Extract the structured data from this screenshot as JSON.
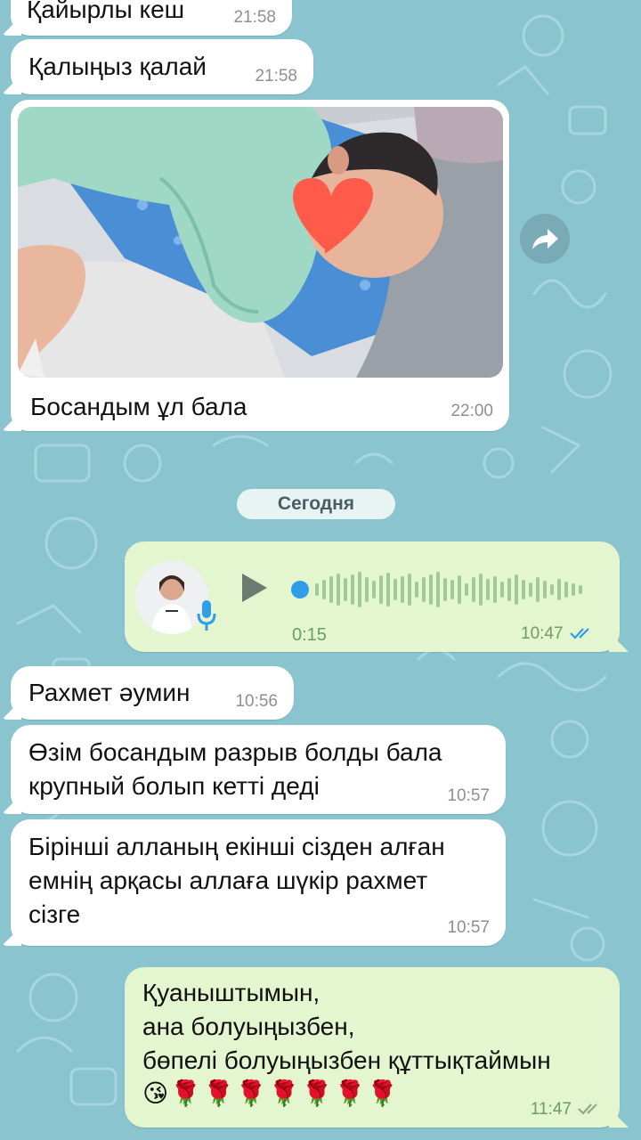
{
  "messages": [
    {
      "text": "Қайырлы кеш",
      "time": "21:58"
    },
    {
      "text": "Қалыңыз қалай",
      "time": "21:58"
    },
    {
      "caption": "Босандым ұл бала",
      "time": "22:00"
    },
    {
      "text": "Рахмет әумин",
      "time": "10:56"
    },
    {
      "text": "Өзім босандым разрыв болды бала\nкрупный болып кетті деді",
      "time": "10:57"
    },
    {
      "text": "Бірінші алланың екінші сізден алған\nемнің арқасы аллаға шүкір рахмет\nсізге",
      "time": "10:57"
    },
    {
      "text": "Қуаныштымын,\nана болуыңызбен,\nбөпелі болуыңызбен құттықтаймын",
      "emoji": "😘🌹🌹🌹🌹🌹🌹🌹",
      "time": "11:47",
      "status": "read"
    }
  ],
  "date_separator": "Сегодня",
  "voice_message": {
    "duration": "0:15",
    "time": "10:47",
    "status": "read"
  },
  "icons": [
    "forward-icon",
    "play-icon",
    "microphone-icon",
    "double-check-icon",
    "heart-sticker"
  ],
  "colors": {
    "wallpaper": "#8ac4cf",
    "incoming": "#ffffff",
    "outgoing": "#e3f6cf",
    "accent": "#2f9de8",
    "outgoing_time": "#6e9c63"
  }
}
